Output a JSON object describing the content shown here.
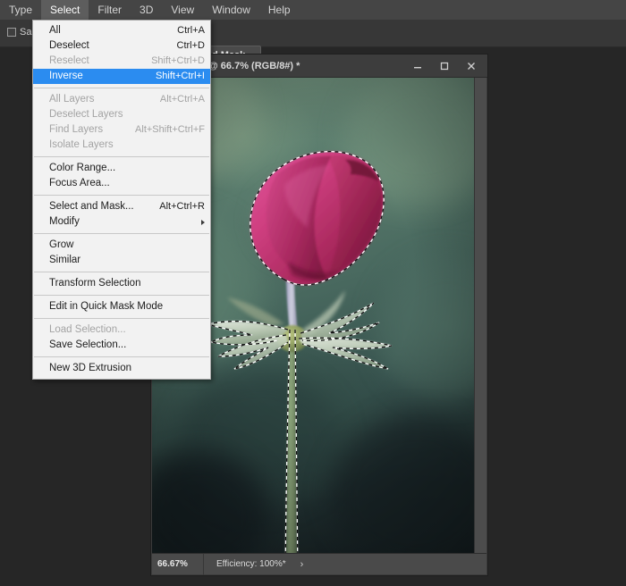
{
  "app": {
    "workspace_bg": "#262626",
    "accent_highlight": "#2b8cf0"
  },
  "menubar": {
    "items": [
      {
        "label": "Type",
        "active": false
      },
      {
        "label": "Select",
        "active": true
      },
      {
        "label": "Filter",
        "active": false
      },
      {
        "label": "3D",
        "active": false
      },
      {
        "label": "View",
        "active": false
      },
      {
        "label": "Window",
        "active": false
      },
      {
        "label": "Help",
        "active": false
      }
    ]
  },
  "options_bar": {
    "sample_checkbox_label": "Sam",
    "sample_checked": false,
    "select_and_mask_button": "d Mask..."
  },
  "select_menu": {
    "groups": [
      {
        "items": [
          {
            "label": "All",
            "shortcut": "Ctrl+A",
            "state": "normal"
          },
          {
            "label": "Deselect",
            "shortcut": "Ctrl+D",
            "state": "normal"
          },
          {
            "label": "Reselect",
            "shortcut": "Shift+Ctrl+D",
            "state": "disabled"
          },
          {
            "label": "Inverse",
            "shortcut": "Shift+Ctrl+I",
            "state": "selected"
          }
        ]
      },
      {
        "items": [
          {
            "label": "All Layers",
            "shortcut": "Alt+Ctrl+A",
            "state": "disabled"
          },
          {
            "label": "Deselect Layers",
            "shortcut": "",
            "state": "disabled"
          },
          {
            "label": "Find Layers",
            "shortcut": "Alt+Shift+Ctrl+F",
            "state": "disabled"
          },
          {
            "label": "Isolate Layers",
            "shortcut": "",
            "state": "disabled"
          }
        ]
      },
      {
        "items": [
          {
            "label": "Color Range...",
            "shortcut": "",
            "state": "normal"
          },
          {
            "label": "Focus Area...",
            "shortcut": "",
            "state": "normal"
          }
        ]
      },
      {
        "items": [
          {
            "label": "Select and Mask...",
            "shortcut": "Alt+Ctrl+R",
            "state": "normal"
          },
          {
            "label": "Modify",
            "shortcut": "",
            "state": "submenu"
          }
        ]
      },
      {
        "items": [
          {
            "label": "Grow",
            "shortcut": "",
            "state": "normal"
          },
          {
            "label": "Similar",
            "shortcut": "",
            "state": "normal"
          }
        ]
      },
      {
        "items": [
          {
            "label": "Transform Selection",
            "shortcut": "",
            "state": "normal"
          }
        ]
      },
      {
        "items": [
          {
            "label": "Edit in Quick Mask Mode",
            "shortcut": "",
            "state": "normal"
          }
        ]
      },
      {
        "items": [
          {
            "label": "Load Selection...",
            "shortcut": "",
            "state": "disabled"
          },
          {
            "label": "Save Selection...",
            "shortcut": "",
            "state": "normal"
          }
        ]
      },
      {
        "items": [
          {
            "label": "New 3D Extrusion",
            "shortcut": "",
            "state": "normal"
          }
        ]
      }
    ]
  },
  "document_window": {
    "title": "@ 66.7% (RGB/8#) *",
    "window_buttons": {
      "minimize": "minimize-icon",
      "maximize": "maximize-icon",
      "close": "close-icon"
    },
    "status_bar": {
      "zoom": "66.67%",
      "efficiency": "Efficiency: 100%*",
      "expand_chevron": "›"
    },
    "canvas": {
      "subject": "pink tulip flower with green stem and pale leaves on blurred green background",
      "selection_active": true,
      "selection_style": "marching-ants-dashed"
    }
  }
}
